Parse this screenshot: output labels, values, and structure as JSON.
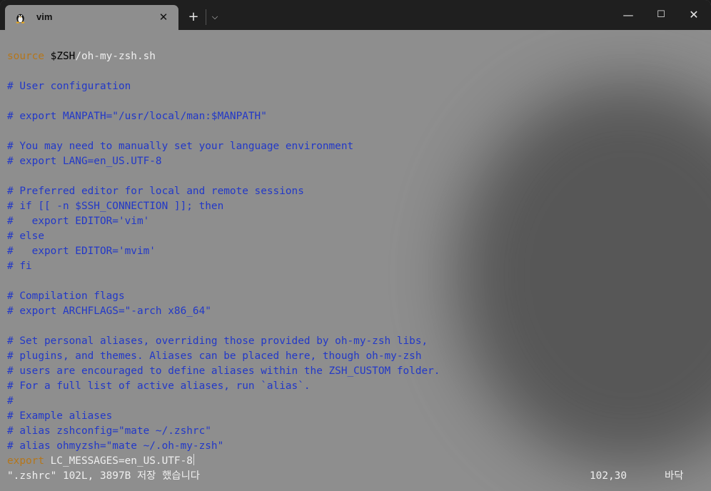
{
  "window": {
    "tab_title": "vim",
    "new_tab_label": "+",
    "dropdown_label": "⌵",
    "close_tab_label": "✕",
    "minimize_label": "—",
    "maximize_label": "☐",
    "close_label": "✕"
  },
  "colors": {
    "comment": "#2238c8",
    "keyword": "#b5761a",
    "variable": "#8a2395",
    "text": "#efefef",
    "background": "#8e8e8e",
    "titlebar": "#1f1f1f"
  },
  "icons": {
    "tab_icon": "linux-tux-icon",
    "close_tab": "close-icon",
    "new_tab": "plus-icon",
    "dropdown": "chevron-down-icon",
    "minimize": "minimize-icon",
    "maximize": "maximize-icon",
    "close": "close-icon"
  },
  "editor": {
    "lines": [
      [
        {
          "t": "source",
          "c": "keyword"
        },
        {
          "t": " ",
          "c": "text"
        },
        {
          "t": "$ZSH",
          "c": "variable"
        },
        {
          "t": "/oh-my-zsh.sh",
          "c": "text"
        }
      ],
      [],
      [
        {
          "t": "# User configuration",
          "c": "comment"
        }
      ],
      [],
      [
        {
          "t": "# export MANPATH=\"/usr/local/man:$MANPATH\"",
          "c": "comment"
        }
      ],
      [],
      [
        {
          "t": "# You may need to manually set your language environment",
          "c": "comment"
        }
      ],
      [
        {
          "t": "# export LANG=en_US.UTF-8",
          "c": "comment"
        }
      ],
      [],
      [
        {
          "t": "# Preferred editor for local and remote sessions",
          "c": "comment"
        }
      ],
      [
        {
          "t": "# if [[ -n $SSH_CONNECTION ]]; then",
          "c": "comment"
        }
      ],
      [
        {
          "t": "#   export EDITOR='vim'",
          "c": "comment"
        }
      ],
      [
        {
          "t": "# else",
          "c": "comment"
        }
      ],
      [
        {
          "t": "#   export EDITOR='mvim'",
          "c": "comment"
        }
      ],
      [
        {
          "t": "# fi",
          "c": "comment"
        }
      ],
      [],
      [
        {
          "t": "# Compilation flags",
          "c": "comment"
        }
      ],
      [
        {
          "t": "# export ARCHFLAGS=\"-arch x86_64\"",
          "c": "comment"
        }
      ],
      [],
      [
        {
          "t": "# Set personal aliases, overriding those provided by oh-my-zsh libs,",
          "c": "comment"
        }
      ],
      [
        {
          "t": "# plugins, and themes. Aliases can be placed here, though oh-my-zsh",
          "c": "comment"
        }
      ],
      [
        {
          "t": "# users are encouraged to define aliases within the ZSH_CUSTOM folder.",
          "c": "comment"
        }
      ],
      [
        {
          "t": "# For a full list of active aliases, run `alias`.",
          "c": "comment"
        }
      ],
      [
        {
          "t": "#",
          "c": "comment"
        }
      ],
      [
        {
          "t": "# Example aliases",
          "c": "comment"
        }
      ],
      [
        {
          "t": "# alias zshconfig=\"mate ~/.zshrc\"",
          "c": "comment"
        }
      ],
      [
        {
          "t": "# alias ohmyzsh=\"mate ~/.oh-my-zsh\"",
          "c": "comment"
        }
      ],
      [
        {
          "t": "export",
          "c": "keyword"
        },
        {
          "t": " LC_MESSAGES=en_US.UTF-8",
          "c": "text",
          "cursor": true
        }
      ]
    ],
    "cursor_line": 27
  },
  "status": {
    "message": "\".zshrc\" 102L, 3897B 저장 했습니다",
    "position": "102,30",
    "scroll": "바닥"
  }
}
